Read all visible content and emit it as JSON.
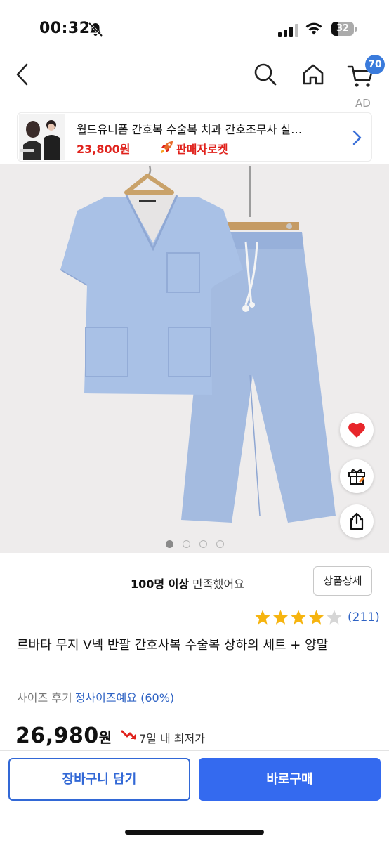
{
  "status_bar": {
    "time": "00:32",
    "battery": "32",
    "battery_level": 0.32,
    "icons": [
      "bell-slash-icon",
      "signal-icon",
      "wifi-icon",
      "battery-icon"
    ]
  },
  "nav": {
    "icons": [
      "back-icon",
      "search-icon",
      "home-icon",
      "cart-icon"
    ],
    "cart_count": "70"
  },
  "ad": {
    "label": "AD",
    "title": "월드유니폼 간호복 수술복 치과 간호조무사 실…",
    "price": "23,800원",
    "seller_badge": "판매자로켓",
    "accent_color": "#e0221c"
  },
  "gallery": {
    "image_description": "light blue scrub top and pants on hangers",
    "dots": 4,
    "active_dot": 0
  },
  "side_actions": [
    "heart-icon",
    "gift-icon",
    "share-icon"
  ],
  "satisfaction": {
    "bold": "100명 이상",
    "rest": " 만족했어요"
  },
  "detail_button": "상품상세",
  "rating": {
    "value": 4,
    "max": 5,
    "count": "(211)"
  },
  "product": {
    "title": "르바타 무지 V넥 반팔 간호사복 수술복 상하의 세트 + 양말"
  },
  "size_review": {
    "label": "사이즈 후기",
    "value": "정사이즈예요 (60%)"
  },
  "price": {
    "amount": "26,980",
    "unit": "원",
    "lowest_label": "7일 내 최저가"
  },
  "bottom": {
    "cart_button": "장바구니 담기",
    "buy_button": "바로구매",
    "primary_color": "#346aef"
  }
}
